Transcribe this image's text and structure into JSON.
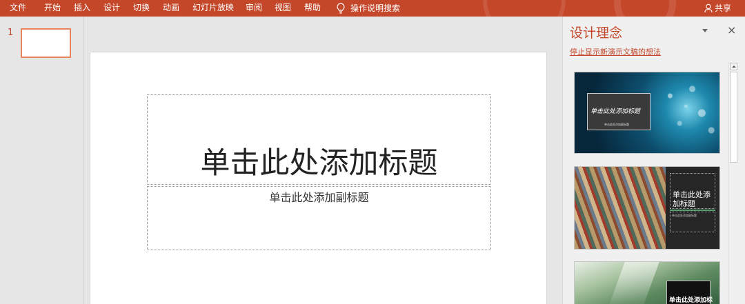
{
  "ribbon": {
    "tabs": [
      "文件",
      "开始",
      "插入",
      "设计",
      "切换",
      "动画",
      "幻灯片放映",
      "审阅",
      "视图",
      "帮助"
    ],
    "search_label": "操作说明搜索",
    "share_label": "共享",
    "accent_color": "#c4472a"
  },
  "thumbnails": {
    "slide_number": "1"
  },
  "slide": {
    "title_placeholder": "单击此处添加标题",
    "subtitle_placeholder": "单击此处添加副标题"
  },
  "designer": {
    "title": "设计理念",
    "stop_link": "停止显示新演示文稿的想法",
    "close_glyph": "×",
    "designs": [
      {
        "title": "单击此处添加标题",
        "subtitle": "单击此处添加副标题"
      },
      {
        "title": "单击此处添加标题",
        "subtitle": "单击此处添加副标题"
      },
      {
        "title": "单击此处添加标"
      }
    ]
  }
}
